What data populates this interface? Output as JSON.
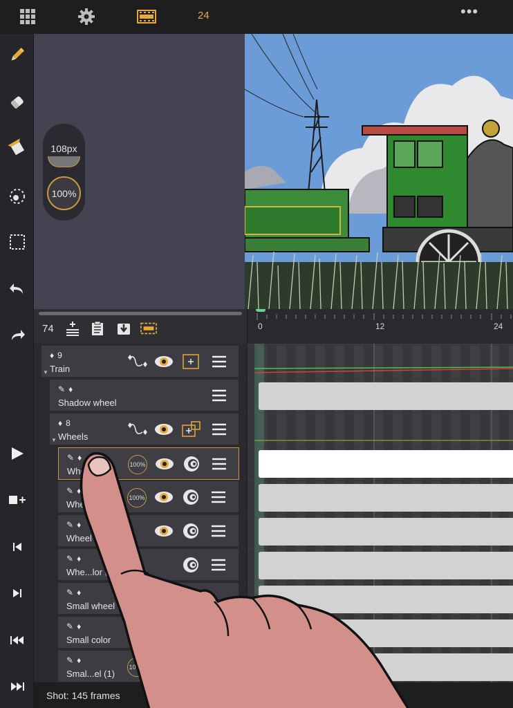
{
  "top_bar": {
    "icons": [
      "grid-icon",
      "gear-icon",
      "film-strip-icon"
    ],
    "frame_rate": "24",
    "more_label": "•••"
  },
  "left_toolbar": {
    "tools": [
      "pencil-icon",
      "eraser-icon",
      "fill-bucket-icon",
      "lasso-icon",
      "selection-rect-icon",
      "undo-icon",
      "redo-icon"
    ],
    "playback": [
      "play-icon",
      "add-frame-icon",
      "step-back-icon",
      "step-forward-icon",
      "jump-start-icon",
      "jump-end-icon"
    ]
  },
  "tool_panel": {
    "brush_size": "108px",
    "opacity": "100%"
  },
  "timeline": {
    "current_frame": "74",
    "ruler_labels": [
      "0",
      "12",
      "24"
    ]
  },
  "layers": [
    {
      "number": "9",
      "name": "Train",
      "type": "group"
    },
    {
      "name": "Shadow wheel",
      "type": "drawing"
    },
    {
      "number": "8",
      "name": "Wheels",
      "type": "group"
    },
    {
      "name": "Whe",
      "opacity": "100%",
      "selected": true
    },
    {
      "name": "Whee",
      "opacity": "100%"
    },
    {
      "name": "Wheel (1",
      "opacity": ""
    },
    {
      "name": "Whe...lor (",
      "opacity": ""
    },
    {
      "name": "Small wheel",
      "opacity": ""
    },
    {
      "name": "Small color",
      "opacity": "82%"
    },
    {
      "name": "Smal...el (1)",
      "opacity": "100%"
    }
  ],
  "status": {
    "shot": "Shot: 145 frames"
  },
  "colors": {
    "accent": "#e8a93b",
    "panel": "#434351",
    "playhead": "#6ad48a"
  }
}
